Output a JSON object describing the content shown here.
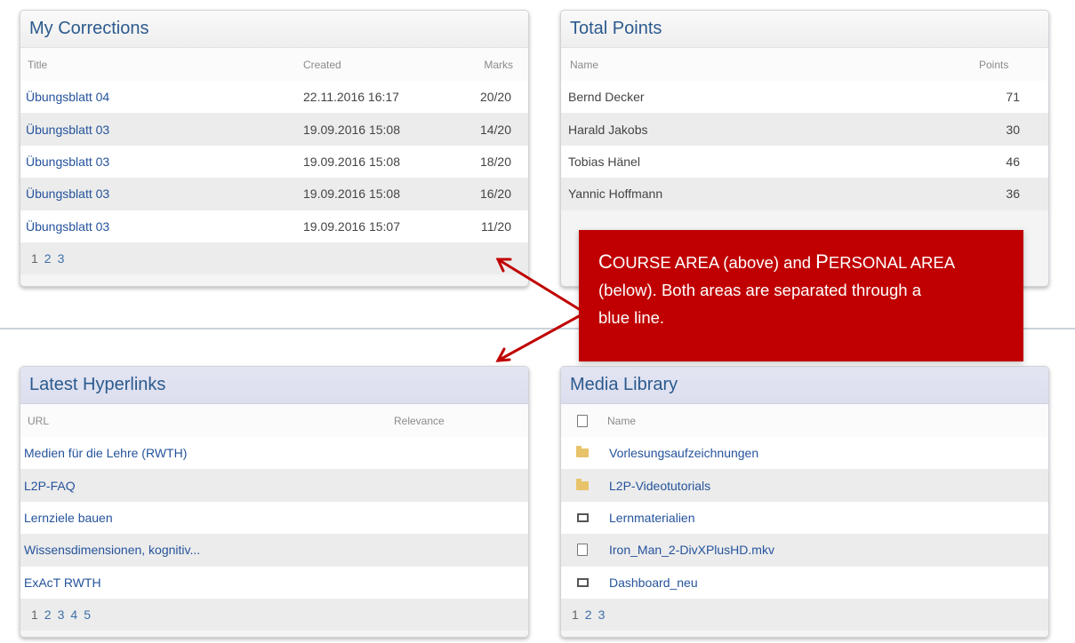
{
  "corrections": {
    "title": "My Corrections",
    "columns": {
      "title": "Title",
      "created": "Created",
      "marks": "Marks"
    },
    "rows": [
      {
        "title": "Übungsblatt 04",
        "created": "22.11.2016 16:17",
        "marks": "20/20"
      },
      {
        "title": "Übungsblatt 03",
        "created": "19.09.2016 15:08",
        "marks": "14/20"
      },
      {
        "title": "Übungsblatt 03",
        "created": "19.09.2016 15:08",
        "marks": "18/20"
      },
      {
        "title": "Übungsblatt 03",
        "created": "19.09.2016 15:08",
        "marks": "16/20"
      },
      {
        "title": "Übungsblatt 03",
        "created": "19.09.2016 15:07",
        "marks": "11/20"
      }
    ],
    "pages": [
      "1",
      "2",
      "3"
    ]
  },
  "points": {
    "title": "Total Points",
    "columns": {
      "name": "Name",
      "points": "Points"
    },
    "rows": [
      {
        "name": "Bernd Decker",
        "points": "71"
      },
      {
        "name": "Harald Jakobs",
        "points": "30"
      },
      {
        "name": "Tobias Hänel",
        "points": "46"
      },
      {
        "name": "Yannic Hoffmann",
        "points": "36"
      }
    ]
  },
  "callout": {
    "course_initial": "C",
    "course_rest": "OURSE AREA",
    "above": " (above) and ",
    "personal_initial": "P",
    "personal_rest": "ERSONAL AREA",
    "line2": "(below). Both areas are separated through a",
    "line3": "blue line."
  },
  "hyperlinks": {
    "title": "Latest Hyperlinks",
    "columns": {
      "url": "URL",
      "relevance": "Relevance"
    },
    "rows": [
      {
        "label": "Medien für die Lehre (RWTH)"
      },
      {
        "label": "L2P-FAQ"
      },
      {
        "label": "Lernziele bauen"
      },
      {
        "label": "Wissensdimensionen, kognitiv..."
      },
      {
        "label": "ExAcT RWTH"
      }
    ],
    "pages": [
      "1",
      "2",
      "3",
      "4",
      "5"
    ]
  },
  "media": {
    "title": "Media Library",
    "columns": {
      "name": "Name"
    },
    "header_icon": "file-icon",
    "rows": [
      {
        "icon": "folder-icon",
        "name": "Vorlesungsaufzeichnungen"
      },
      {
        "icon": "folder-icon",
        "name": "L2P-Videotutorials"
      },
      {
        "icon": "frame-icon",
        "name": "Lernmaterialien"
      },
      {
        "icon": "file-icon",
        "name": "Iron_Man_2-DivXPlusHD.mkv"
      },
      {
        "icon": "frame-icon",
        "name": "Dashboard_neu"
      }
    ],
    "pages": [
      "1",
      "2",
      "3"
    ]
  },
  "colors": {
    "link": "#25539c",
    "callout_bg": "#c00000",
    "divider": "#c9d2dc",
    "header_text": "#2b5a8e"
  }
}
